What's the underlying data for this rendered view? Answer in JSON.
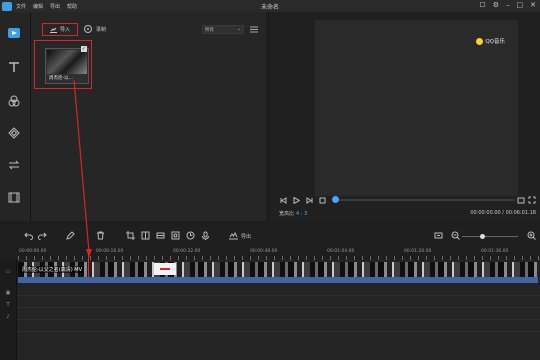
{
  "app": {
    "title": "未命名",
    "menu": [
      "文件",
      "编辑",
      "导出",
      "帮助"
    ]
  },
  "toolbar_left": {
    "items": [
      "media-icon",
      "text-icon",
      "filter-icon",
      "overlay-icon",
      "transition-icon",
      "element-icon"
    ]
  },
  "media_panel": {
    "import_label": "导入",
    "record_label": "录制",
    "filter_value": "所有",
    "clip_name": "周杰伦-以...",
    "clip_badge": "✓"
  },
  "preview": {
    "watermark": "QQ音乐",
    "aspect_label": "宽高比",
    "aspect_value": "4 : 3",
    "time": "00:00:00.00 / 00:06:01.18"
  },
  "timeline": {
    "export_label": "导出",
    "ruler": [
      "00:00:00.00",
      "00:00:16.00",
      "00:00:32.00",
      "00:00:48.00",
      "00:01:04.00",
      "00:01:20.00",
      "00:01:36.00"
    ],
    "clip_title": "周杰伦-以父之名(高清) MV"
  },
  "colors": {
    "accent": "#4ba3ff",
    "highlight": "#d42727",
    "audio_track": "#3f64a8"
  }
}
